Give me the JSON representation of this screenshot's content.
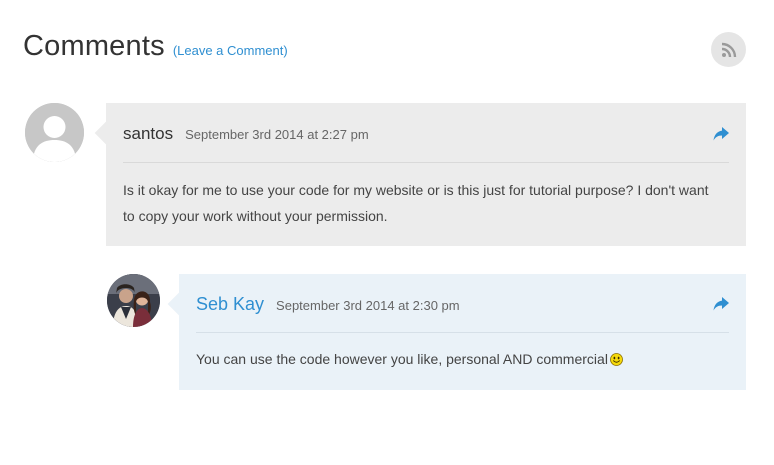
{
  "header": {
    "title": "Comments",
    "leave_comment": "(Leave a Comment)",
    "rss_icon": "rss-icon"
  },
  "comments": [
    {
      "author": "santos",
      "date": "September 3rd 2014 at 2:27 pm",
      "text": "Is it okay for me to use your code for my website or is this just for tutorial purpose? I don't want to copy your work without your permission.",
      "avatar": "default-avatar-icon",
      "reply_icon": "reply-icon"
    },
    {
      "author": "Seb Kay",
      "date": "September 3rd 2014 at 2:30 pm",
      "text": "You can use the code however you like, personal AND commercial",
      "emoji": "smiley-emoji",
      "avatar": "user-photo",
      "reply_icon": "reply-icon"
    }
  ],
  "colors": {
    "accent": "#2f8fd1",
    "card_bg": "#ececec",
    "reply_card_bg": "#eaf2f8"
  }
}
